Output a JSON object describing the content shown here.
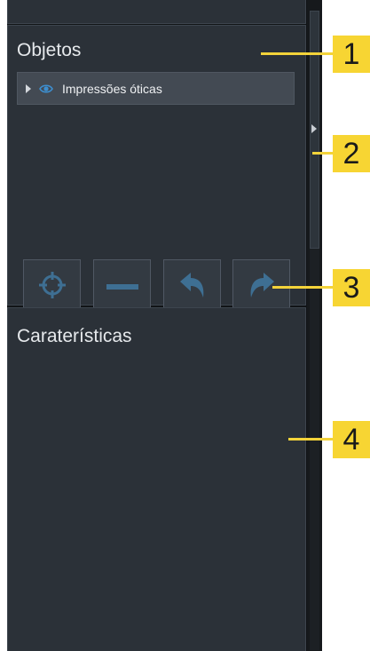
{
  "objects_panel": {
    "title": "Objetos",
    "tree_items": [
      {
        "label": "Impressões óticas"
      }
    ]
  },
  "toolbar": {
    "buttons": [
      "target-icon",
      "minus-icon",
      "undo-icon",
      "redo-icon"
    ]
  },
  "properties_panel": {
    "title": "Caraterísticas"
  },
  "callouts": [
    "1",
    "2",
    "3",
    "4"
  ],
  "colors": {
    "panel_bg": "#2b3138",
    "callout": "#f7d533",
    "icon": "#3d8fd0"
  }
}
